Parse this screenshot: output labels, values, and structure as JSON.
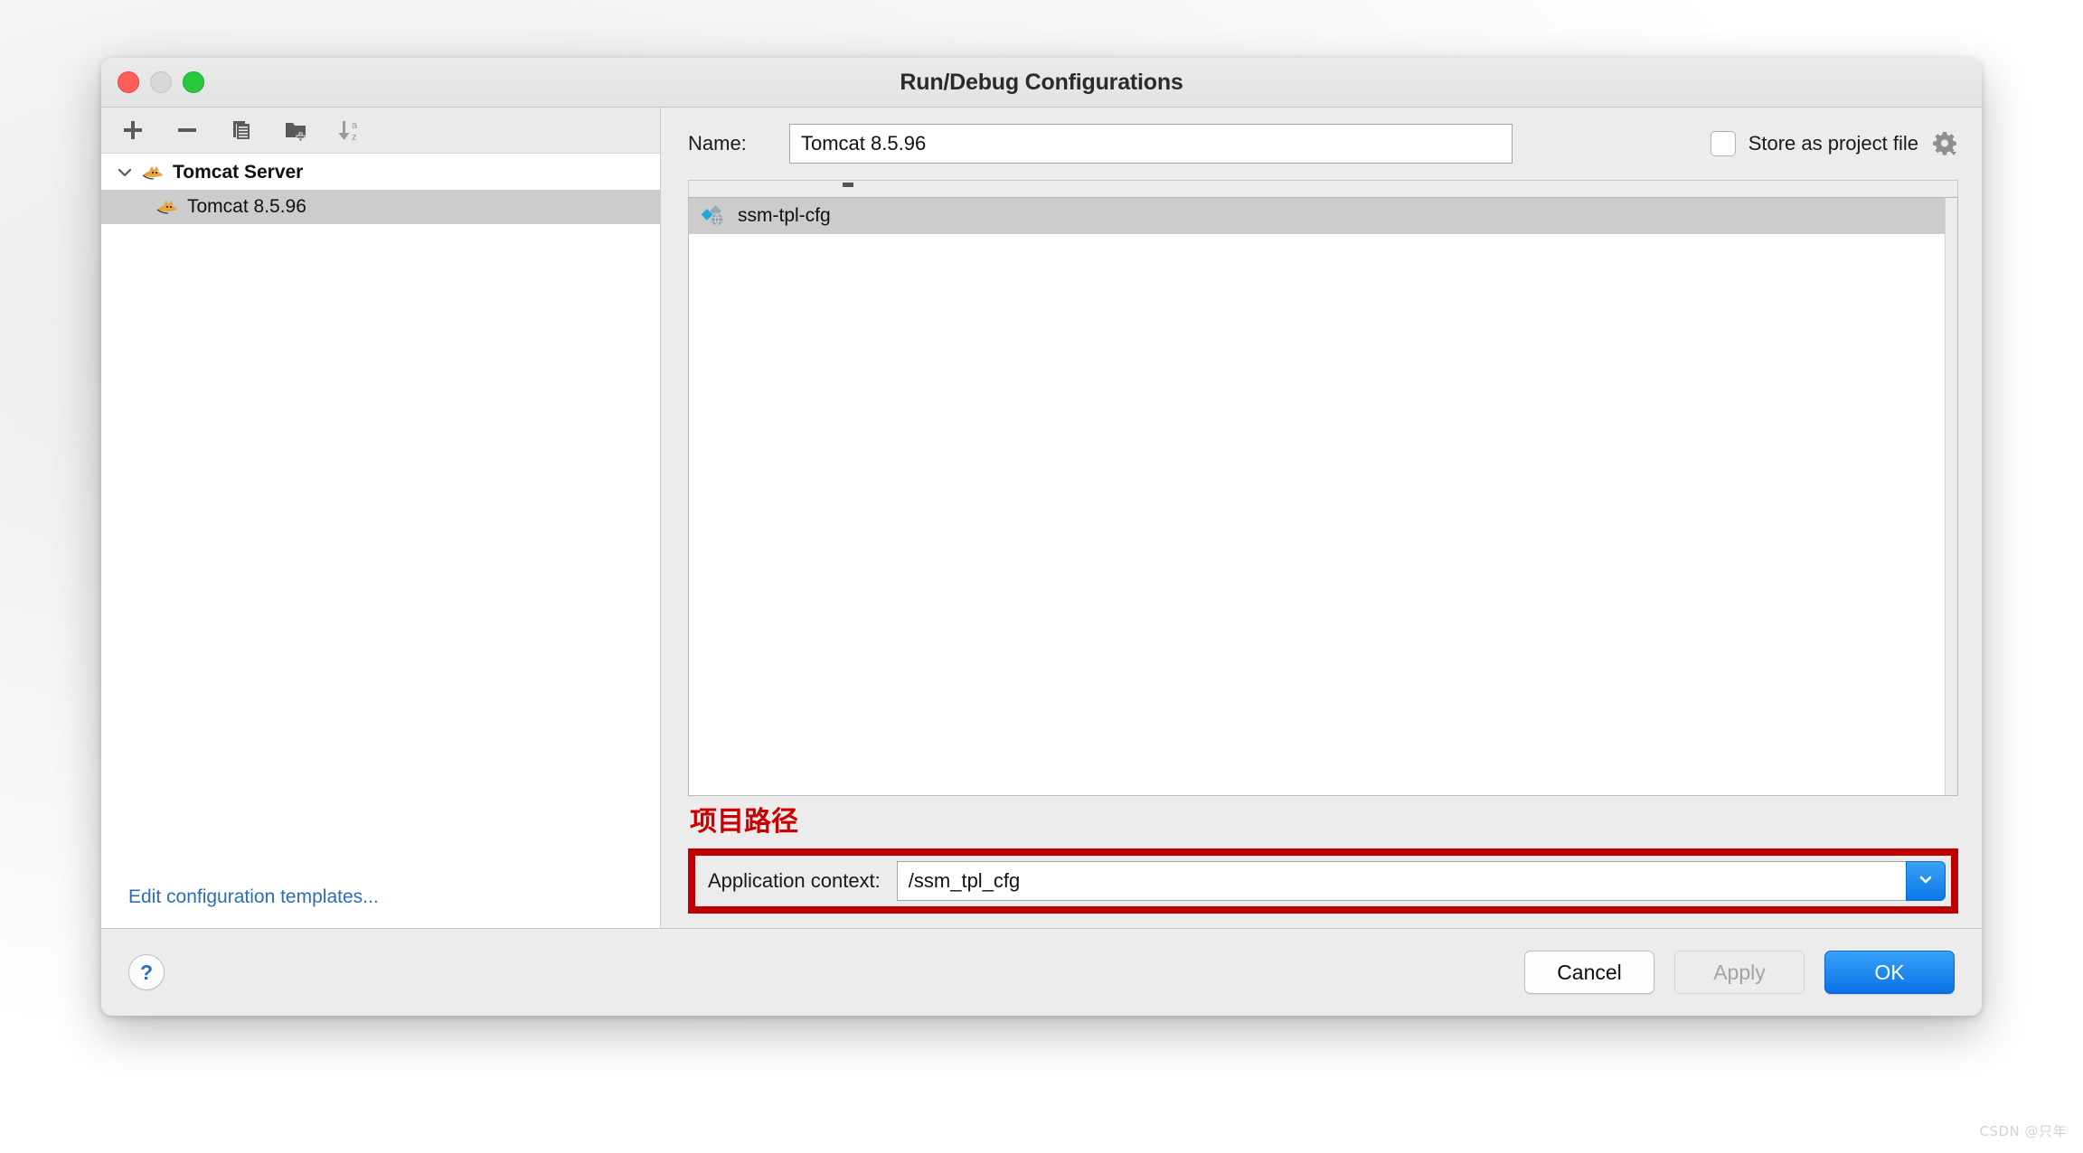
{
  "window": {
    "title": "Run/Debug Configurations",
    "traffic_lights": [
      "close-red",
      "minimize-yellow",
      "zoom-green"
    ]
  },
  "sidebar": {
    "toolbar": [
      {
        "name": "add-configuration-button",
        "icon": "plus-icon",
        "label": "+"
      },
      {
        "name": "remove-configuration-button",
        "icon": "minus-icon",
        "label": "−"
      },
      {
        "name": "copy-configuration-button",
        "icon": "copy-icon",
        "label": "Copy"
      },
      {
        "name": "new-folder-button",
        "icon": "folder-add-icon",
        "label": "New Folder"
      },
      {
        "name": "sort-configurations-button",
        "icon": "sort-az-icon",
        "label": "Sort a-z"
      }
    ],
    "tree": [
      {
        "label": "Tomcat Server",
        "icon": "tomcat-icon",
        "expanded": true,
        "selected": false
      },
      {
        "label": "Tomcat 8.5.96",
        "icon": "tomcat-icon",
        "selected": true
      }
    ],
    "edit_templates_link": "Edit configuration templates..."
  },
  "form": {
    "name_label": "Name:",
    "name_value": "Tomcat 8.5.96",
    "name_placeholder": "Name",
    "store_as_project_file_label": "Store as project file",
    "store_as_project_file_checked": false,
    "gear_icon": "gear-icon"
  },
  "artifacts": {
    "items": [
      {
        "label": "ssm-tpl-cfg",
        "icon": "artifact-icon",
        "selected": true
      }
    ]
  },
  "annotation": {
    "text": "项目路径",
    "color": "#cc0000"
  },
  "application_context": {
    "label": "Application context:",
    "value": "/ssm_tpl_cfg",
    "placeholder": "/context",
    "dropdown_icon": "chevron-down-icon",
    "highlight_color": "#c00000"
  },
  "footer": {
    "help_label": "?",
    "cancel_label": "Cancel",
    "apply_label": "Apply",
    "apply_enabled": false,
    "ok_label": "OK"
  },
  "watermark": "CSDN @只年",
  "colors": {
    "accent_blue": "#0a72e6",
    "link_blue": "#2a6ebb",
    "highlight_red": "#c00000",
    "selection_gray": "#cccccc"
  }
}
